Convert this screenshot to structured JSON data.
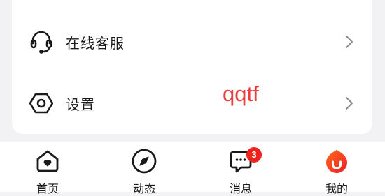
{
  "menu": {
    "items": [
      {
        "label": "在线客服",
        "icon": "headset-icon"
      },
      {
        "label": "设置",
        "icon": "hexagon-settings-icon"
      }
    ]
  },
  "watermark": {
    "text": "qqtf"
  },
  "tabbar": {
    "tabs": [
      {
        "label": "首页",
        "icon": "home-heart-icon"
      },
      {
        "label": "动态",
        "icon": "compass-icon"
      },
      {
        "label": "消息",
        "icon": "chat-bubble-icon",
        "badge": "3"
      },
      {
        "label": "我的",
        "icon": "profile-logo-icon",
        "active": true
      }
    ]
  },
  "colors": {
    "accent": "#ef3b3b",
    "badge": "#f0221e",
    "background": "#f2f2f4"
  }
}
